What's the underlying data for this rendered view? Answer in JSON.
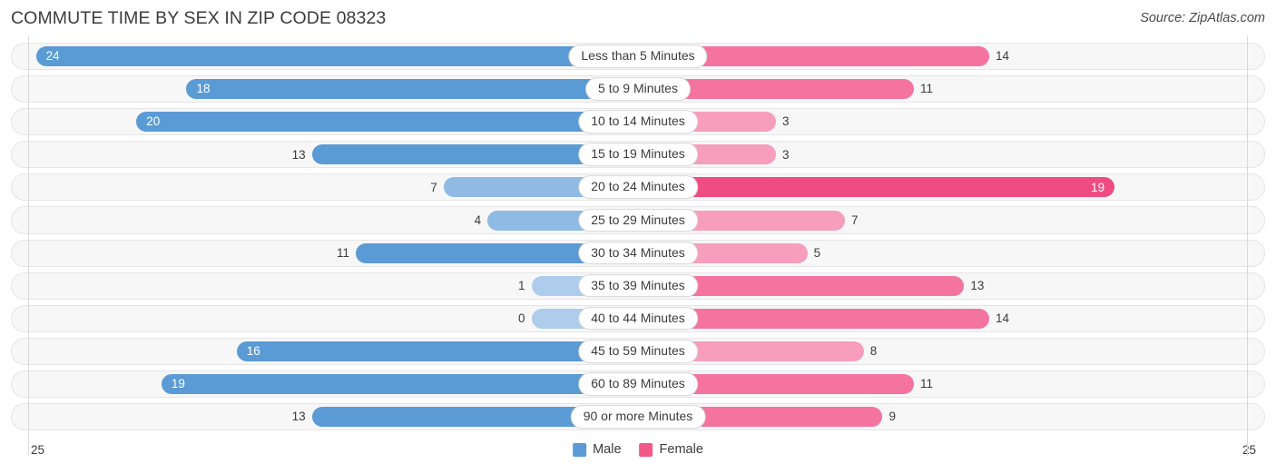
{
  "header": {
    "title": "COMMUTE TIME BY SEX IN ZIP CODE 08323",
    "source": "Source: ZipAtlas.com"
  },
  "legend": {
    "male_label": "Male",
    "female_label": "Female",
    "male_color": "#5b9bd5",
    "female_color": "#f2588a"
  },
  "axis": {
    "left_max": "25",
    "right_max": "25"
  },
  "chart_data": {
    "type": "bar",
    "subtype": "diverging-horizontal-bar",
    "title": "COMMUTE TIME BY SEX IN ZIP CODE 08323",
    "xlabel": "",
    "ylabel": "",
    "xlim": [
      25,
      25
    ],
    "grid": false,
    "legend_position": "bottom-center",
    "categories": [
      "Less than 5 Minutes",
      "5 to 9 Minutes",
      "10 to 14 Minutes",
      "15 to 19 Minutes",
      "20 to 24 Minutes",
      "25 to 29 Minutes",
      "30 to 34 Minutes",
      "35 to 39 Minutes",
      "40 to 44 Minutes",
      "45 to 59 Minutes",
      "60 to 89 Minutes",
      "90 or more Minutes"
    ],
    "series": [
      {
        "name": "Male",
        "values": [
          24,
          18,
          20,
          13,
          7,
          4,
          11,
          1,
          0,
          16,
          19,
          13
        ]
      },
      {
        "name": "Female",
        "values": [
          14,
          11,
          3,
          3,
          19,
          7,
          5,
          13,
          14,
          8,
          11,
          9
        ]
      }
    ]
  },
  "rows": [
    {
      "label": "Less than 5 Minutes",
      "male": "24",
      "male_w": 96.0,
      "male_shade": "dark",
      "male_inside": true,
      "female": "14",
      "female_w": 56.0,
      "female_shade": "mid",
      "female_inside": false
    },
    {
      "label": "5 to 9 Minutes",
      "male": "18",
      "male_w": 72.0,
      "male_shade": "dark",
      "male_inside": true,
      "female": "11",
      "female_w": 44.0,
      "female_shade": "mid",
      "female_inside": false
    },
    {
      "label": "10 to 14 Minutes",
      "male": "20",
      "male_w": 80.0,
      "male_shade": "dark",
      "male_inside": true,
      "female": "3",
      "female_w": 22.0,
      "female_shade": "light",
      "female_inside": false
    },
    {
      "label": "15 to 19 Minutes",
      "male": "13",
      "male_w": 52.0,
      "male_shade": "dark",
      "male_inside": false,
      "female": "3",
      "female_w": 22.0,
      "female_shade": "light",
      "female_inside": false
    },
    {
      "label": "20 to 24 Minutes",
      "male": "7",
      "male_w": 31.0,
      "male_shade": "mid",
      "male_inside": false,
      "female": "19",
      "female_w": 76.0,
      "female_shade": "dark",
      "female_inside": true
    },
    {
      "label": "25 to 29 Minutes",
      "male": "4",
      "male_w": 24.0,
      "male_shade": "mid",
      "male_inside": false,
      "female": "7",
      "female_w": 33.0,
      "female_shade": "light",
      "female_inside": false
    },
    {
      "label": "30 to 34 Minutes",
      "male": "11",
      "male_w": 45.0,
      "male_shade": "dark",
      "male_inside": false,
      "female": "5",
      "female_w": 27.0,
      "female_shade": "light",
      "female_inside": false
    },
    {
      "label": "35 to 39 Minutes",
      "male": "1",
      "male_w": 17.0,
      "male_shade": "light",
      "male_inside": false,
      "female": "13",
      "female_w": 52.0,
      "female_shade": "mid",
      "female_inside": false
    },
    {
      "label": "40 to 44 Minutes",
      "male": "0",
      "male_w": 17.0,
      "male_shade": "light",
      "male_inside": false,
      "female": "14",
      "female_w": 56.0,
      "female_shade": "mid",
      "female_inside": false
    },
    {
      "label": "45 to 59 Minutes",
      "male": "16",
      "male_w": 64.0,
      "male_shade": "dark",
      "male_inside": true,
      "female": "8",
      "female_w": 36.0,
      "female_shade": "light",
      "female_inside": false
    },
    {
      "label": "60 to 89 Minutes",
      "male": "19",
      "male_w": 76.0,
      "male_shade": "dark",
      "male_inside": true,
      "female": "11",
      "female_w": 44.0,
      "female_shade": "mid",
      "female_inside": false
    },
    {
      "label": "90 or more Minutes",
      "male": "13",
      "male_w": 52.0,
      "male_shade": "dark",
      "male_inside": false,
      "female": "9",
      "female_w": 39.0,
      "female_shade": "mid",
      "female_inside": false
    }
  ],
  "colors": {
    "male_dark": "#5b9bd5",
    "male_mid": "#8ebae4",
    "male_light": "#aecdec",
    "female_dark": "#ef4c84",
    "female_mid": "#f4749f",
    "female_light": "#f79ebc",
    "track_bg": "#f7f7f7",
    "track_border": "#e6e6e6"
  }
}
